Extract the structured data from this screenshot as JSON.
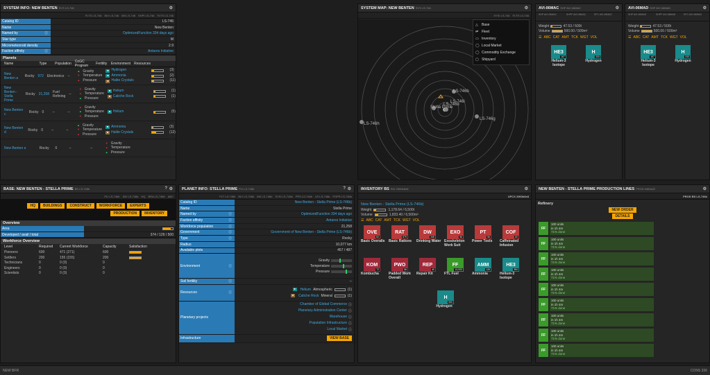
{
  "sysinfo": {
    "title": "SYSTEM INFO: NEW BENTEN",
    "code": "SYS LS-746",
    "tabs": [
      "FLTS LS-746",
      "INV LS-746",
      "MS LS-746",
      "SHPI LS-746",
      "FLTS LS-746"
    ],
    "rows": [
      {
        "label": "Catalog ID",
        "value": "LS-746",
        "info": false
      },
      {
        "label": "Name",
        "value": "New Benten",
        "info": false
      },
      {
        "label": "Named by",
        "value": "OptimizedFunction 334 days ago",
        "info": true
      },
      {
        "label": "Star type",
        "value": "M",
        "info": false
      },
      {
        "label": "Micrometeoroid density",
        "value": "2.9",
        "info": false
      },
      {
        "label": "Faction affinity",
        "value": "Antares Initiative",
        "info": true
      }
    ],
    "planets_title": "Planets",
    "cols": [
      "Name",
      "Type",
      "Population",
      "CoGC Program",
      "Fertility",
      "Environment",
      "Resources"
    ],
    "planets": [
      {
        "name": "New Benten a",
        "type": "Rocky",
        "pop": "972",
        "cogc": "Electronics",
        "fert": "--",
        "env": [
          "Gravity",
          "Temperature",
          "Pressure"
        ],
        "res": [
          {
            "n": "Hydrogen",
            "c": "(3)"
          },
          {
            "n": "Ammonia",
            "c": "(2)"
          },
          {
            "n": "Halite Crystals",
            "c": "(11)"
          }
        ]
      },
      {
        "name": "New Benten - Stella Prime",
        "type": "Rocky",
        "pop": "21,258",
        "cogc": "Fuel Refining",
        "fert": "--",
        "env": [
          "Gravity",
          "Temperature",
          "Pressure"
        ],
        "res": [
          {
            "n": "Helium",
            "c": "(1)"
          },
          {
            "n": "Caliche Rock",
            "c": "(1)"
          }
        ]
      },
      {
        "name": "New Benten c",
        "type": "Rocky",
        "pop": "0",
        "cogc": "--",
        "fert": "--",
        "env": [
          "Gravity",
          "Temperature",
          "Pressure"
        ],
        "res": [
          {
            "n": "Helium",
            "c": "(5)"
          }
        ]
      },
      {
        "name": "New Benten d",
        "type": "Rocky",
        "pop": "0",
        "cogc": "--",
        "fert": "--",
        "env": [
          "Gravity",
          "Temperature",
          "Pressure"
        ],
        "res": [
          {
            "n": "Ammonia",
            "c": "(3)"
          },
          {
            "n": "Halite Crystals",
            "c": "(12)"
          }
        ]
      },
      {
        "name": "New Benten e",
        "type": "Rocky",
        "pop": "0",
        "cogc": "--",
        "fert": "--",
        "env": [
          "Gravity",
          "Temperature",
          "Pressure"
        ],
        "res": []
      }
    ]
  },
  "sysmap": {
    "title": "SYSTEM MAP: NEW BENTEN",
    "code": "SYS LS-746",
    "tabs": [
      "SYSI LS-746",
      "FLTS LS-746"
    ],
    "legend": [
      "Base",
      "Fleet",
      "Inventory",
      "Local Market",
      "Commodity Exchange",
      "Shipyard"
    ],
    "labels": [
      "LS-746b",
      "LS-746h",
      "LS-746g",
      "LS-746i",
      "Stella Prime",
      "LS-746d"
    ]
  },
  "ship1": {
    "title": "AVI-06MAC",
    "code": "SHP AVI-06MAC",
    "tabs": [
      "SHP AVI-06MAC",
      "SHPF AVI-06MAC",
      "SFC AVI-06MAC"
    ],
    "weight": "47.53 / 500t",
    "volume": "500.00 / 500m³",
    "sorts": [
      "ABC",
      "CAT",
      "AMT",
      "TCK",
      "WGT",
      "VOL"
    ],
    "items": [
      {
        "t": "HE3",
        "n": "Helium-3 Isotope",
        "c": "167"
      },
      {
        "t": "H",
        "n": "Hydrogen",
        "c": "333"
      }
    ]
  },
  "ship2": {
    "title": "AVI-06MAD",
    "code": "SHP AVI-06MAD",
    "tabs": [
      "SHP AVI-06MAD",
      "SHPF AVI-06MAD",
      "SFC AVI-06MAD"
    ],
    "weight": "47.53 / 500t",
    "volume": "500.00 / 500m³",
    "sorts": [
      "ABC",
      "CAT",
      "AMT",
      "TCK",
      "WGT",
      "VOL"
    ],
    "items": [
      {
        "t": "HE3",
        "n": "Helium-3 Isotope",
        "c": "167"
      },
      {
        "t": "H",
        "n": "Hydrogen",
        "c": "333"
      }
    ]
  },
  "base": {
    "title": "BASE: NEW BENTEN - STELLA PRIME",
    "code": "BS LS-746b",
    "tabs": [
      "PLI LS-746b",
      "INV LS-746b",
      "HQ",
      "BRA LS-746b",
      "ABC"
    ],
    "buttons1": [
      "HQ",
      "BUILDINGS",
      "CONSTRUCT",
      "WORKFORCE",
      "EXPERTS"
    ],
    "buttons2": [
      "PRODUCTION",
      "INVENTORY"
    ],
    "overview": "Overview",
    "area_lbl": "Area",
    "dev_lbl": "Developed / avail / total",
    "dev_val": "374 / 126 / 500",
    "wf_title": "Workforce Overview",
    "wf_cols": [
      "Level",
      "Required",
      "Current Workforce",
      "Capacity",
      "Satisfaction"
    ],
    "wf": [
      {
        "l": "Pioneers",
        "r": "600",
        "c": "471 (271)",
        "cap": "600"
      },
      {
        "l": "Settlers",
        "r": "200",
        "c": "155 (155)",
        "cap": "200"
      },
      {
        "l": "Technicians",
        "r": "0",
        "c": "0 (0)",
        "cap": "0"
      },
      {
        "l": "Engineers",
        "r": "0",
        "c": "0 (0)",
        "cap": "0"
      },
      {
        "l": "Scientists",
        "r": "0",
        "c": "0 (0)",
        "cap": "0"
      }
    ]
  },
  "planet": {
    "title": "PLANET INFO: STELLA PRIME",
    "code": "PLI LS-746b",
    "tabs": [
      "FLT LS-746b",
      "INV LS-746b",
      "MS LS-746b",
      "SYSI LS-746b",
      "PPS LS-746b",
      "LR LS-746b",
      "POPR LS-746b"
    ],
    "rows": [
      {
        "label": "Catalog ID",
        "value": "New Benten - Stella Prime (LS-746b)",
        "info": false,
        "link": true
      },
      {
        "label": "Name",
        "value": "Stella Prime",
        "info": false
      },
      {
        "label": "Named by",
        "value": "OptimizedFunction 334 days ago",
        "info": true,
        "link": true
      },
      {
        "label": "Faction affinity",
        "value": "Antares Initiative",
        "info": true,
        "link": true
      },
      {
        "label": "Workforce population",
        "value": "21,258",
        "info": true
      },
      {
        "label": "Government",
        "value": "Government of New Benten - Stella Prime (LS-746b)",
        "info": true,
        "link": true
      },
      {
        "label": "Type",
        "value": "Rocky",
        "info": true
      },
      {
        "label": "Radius",
        "value": "10,077 km",
        "info": false
      },
      {
        "label": "Available plots",
        "value": "457 / 487",
        "info": false
      }
    ],
    "env_label": "Environment",
    "env": [
      "Gravity",
      "Temperature",
      "Pressure"
    ],
    "soil": "Soil fertility",
    "soil_val": "--",
    "res_label": "Resources",
    "res": [
      {
        "n": "Helium",
        "t": "Atmospheric",
        "c": "(1)"
      },
      {
        "n": "Caliche Rock",
        "t": "Mineral",
        "c": "(1)"
      }
    ],
    "proj_label": "Planetary projects",
    "proj": [
      "Chamber of Global Commerce",
      "Planetary Administration Center",
      "Warehouse",
      "Population Infrastructure",
      "Local Market"
    ],
    "infra": "Infrastructure",
    "view_base": "VIEW BASE"
  },
  "inventory": {
    "title": "INVENTORY BS",
    "code": "INV 2960b6e8",
    "tab": "UPCX 2960b6e8",
    "loc": "New Benten - Stella Prime (LS-746b)",
    "weight": "1,178.64 / 6,500t",
    "volume": "1,833.40 / 6,500m³",
    "sorts": [
      "ABC",
      "CAT",
      "AMT",
      "TCK",
      "WGT",
      "VOL"
    ],
    "items": [
      {
        "t": "OVE",
        "n": "Basic Overalls",
        "c": "84",
        "col": "#b83a3a"
      },
      {
        "t": "RAT",
        "n": "Basic Rations",
        "c": "879",
        "col": "#b83a3a"
      },
      {
        "t": "DW",
        "n": "Drinking Water",
        "c": "345",
        "col": "#b83a3a"
      },
      {
        "t": "EXO",
        "n": "Exoskeleton Work Suit",
        "c": "56",
        "col": "#b83a3a"
      },
      {
        "t": "PT",
        "n": "Power Tools",
        "c": "56",
        "col": "#b83a3a"
      },
      {
        "t": "COF",
        "n": "Caffeinated Infusion",
        "c": "60",
        "col": "#b83a3a"
      },
      {
        "t": "KOM",
        "n": "Kombucha",
        "c": "72",
        "col": "#a02a3a"
      },
      {
        "t": "PWO",
        "n": "Padded Work Overall",
        "c": "56",
        "col": "#a02a3a"
      },
      {
        "t": "REP",
        "n": "Repair Kit",
        "c": "40",
        "col": "#a02a3a"
      },
      {
        "t": "FF",
        "n": "FTL Fuel",
        "c": "13,000",
        "col": "#3a9a2a"
      },
      {
        "t": "AMM",
        "n": "Ammonia",
        "c": "126",
        "col": "#1a8a8a"
      },
      {
        "t": "HE3",
        "n": "Helium-3 Isotope",
        "c": "384",
        "col": "#1a8a8a"
      },
      {
        "t": "H",
        "n": "Hydrogen",
        "c": "590",
        "col": "#1a8a8a"
      }
    ]
  },
  "prod": {
    "title": "NEW BENTEN - STELLA PRIME PRODUCTION LINES",
    "code": "PROD fcf69a22",
    "tabs": [
      "PROD BS LS-746b"
    ],
    "line": "Refinery",
    "new_order": "NEW ORDER",
    "details": "DETAILS",
    "orders": [
      {
        "a": "100 units",
        "b": "in 1h 4m",
        "c": "71% done"
      },
      {
        "a": "100 units",
        "b": "in 1h 4m",
        "c": "71% done"
      },
      {
        "a": "100 units",
        "b": "in 1h 4m",
        "c": "71% done"
      },
      {
        "a": "100 units",
        "b": "in 1h 4m",
        "c": "71% done"
      },
      {
        "a": "100 units",
        "b": "in 1h 4m",
        "c": "71% done"
      },
      {
        "a": "100 units",
        "b": "in 1h 4m",
        "c": "71% done"
      },
      {
        "a": "100 units",
        "b": "in 1h 4m",
        "c": "71% done"
      },
      {
        "a": "100 units",
        "b": "in 1h 4m",
        "c": "71% done"
      },
      {
        "a": "100 units",
        "b": "in 1h 4m",
        "c": "71% done"
      }
    ]
  },
  "status": {
    "left": "NEW BFR",
    "right": "CONS 336"
  },
  "colors": {
    "accent": "#f7a600",
    "label_blue": "#2a7ab5",
    "link": "#3fa9e0"
  }
}
